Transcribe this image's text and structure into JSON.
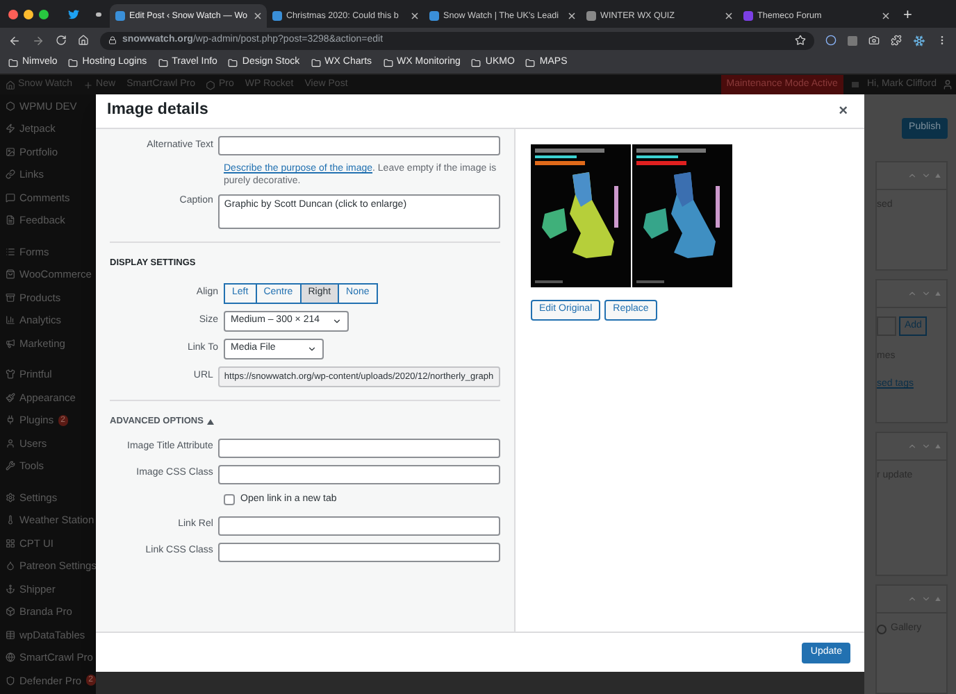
{
  "browser": {
    "tabs": [
      {
        "title": "Edit Post ‹ Snow Watch — Wo",
        "selected": true
      },
      {
        "title": "Christmas 2020: Could this b",
        "selected": false
      },
      {
        "title": "Snow Watch | The UK's Leadi",
        "selected": false
      },
      {
        "title": "WINTER WX QUIZ",
        "selected": false
      },
      {
        "title": "Themeco Forum",
        "selected": false
      }
    ],
    "new_tab": "+",
    "address": "**snowwatch.org**/wp-admin/post.php?post=3298&action=edit",
    "bookmarks": [
      "Nimvelo",
      "Hosting Logins",
      "Travel Info",
      "Design Stock",
      "WX Charts",
      "WX Monitoring",
      "UKMO",
      "MAPS"
    ]
  },
  "admin_bar": {
    "items": [
      "Snow Watch",
      "New",
      "SmartCrawl Pro",
      "Pro",
      "WP Rocket",
      "View Post"
    ],
    "notice": "Maintenance Mode Active",
    "greeting": "Hi, Mark Clifford"
  },
  "sidebar": {
    "groups": [
      [
        {
          "label": "WPMU DEV"
        },
        {
          "label": "Jetpack"
        },
        {
          "label": "Portfolio"
        },
        {
          "label": "Links"
        },
        {
          "label": "Comments"
        },
        {
          "label": "Feedback"
        }
      ],
      [
        {
          "label": "Forms"
        },
        {
          "label": "WooCommerce"
        },
        {
          "label": "Products"
        },
        {
          "label": "Analytics"
        },
        {
          "label": "Marketing"
        }
      ],
      [
        {
          "label": "Printful"
        },
        {
          "label": "Appearance"
        },
        {
          "label": "Plugins",
          "badge": "2"
        },
        {
          "label": "Users"
        },
        {
          "label": "Tools"
        }
      ],
      [
        {
          "label": "Settings"
        },
        {
          "label": "Weather Station"
        },
        {
          "label": "CPT UI"
        },
        {
          "label": "Patreon Settings"
        },
        {
          "label": "Shipper"
        },
        {
          "label": "Branda Pro"
        },
        {
          "label": "wpDataTables"
        },
        {
          "label": "SmartCrawl Pro"
        },
        {
          "label": "Defender Pro",
          "badge": "2"
        }
      ]
    ]
  },
  "dialog": {
    "title": "Image details",
    "close": "×",
    "alt_text": {
      "label": "Alternative Text",
      "help_link": "Describe the purpose of the image",
      "help": ". Leave empty if the image is purely decorative."
    },
    "caption": {
      "label": "Caption",
      "value": "Graphic by Scott Duncan (click to enlarge)"
    },
    "display_heading": "DISPLAY SETTINGS",
    "align": {
      "label": "Align",
      "options": [
        {
          "label": "Left",
          "selected": false
        },
        {
          "label": "Centre",
          "selected": false
        },
        {
          "label": "Right",
          "selected": true
        },
        {
          "label": "None",
          "selected": false
        }
      ]
    },
    "size": {
      "label": "Size",
      "value": "Medium – 300 × 214"
    },
    "link_to": {
      "label": "Link To",
      "value": "Media File"
    },
    "url": {
      "label": "URL",
      "value": "https://snowwatch.org/wp-content/uploads/2020/12/northerly_graph"
    },
    "advanced": {
      "heading": "ADVANCED OPTIONS",
      "expanded": true
    },
    "advanced_fields": [
      {
        "kind": "input",
        "label": "Image Title Attribute"
      },
      {
        "kind": "input",
        "label": "Image CSS Class"
      },
      {
        "kind": "checkbox",
        "label": "Open link in a new tab",
        "checked": false
      },
      {
        "kind": "input",
        "label": "Link Rel"
      },
      {
        "kind": "input",
        "label": "Link CSS Class"
      }
    ],
    "image_buttons": [
      "Edit Original",
      "Replace"
    ],
    "update_button": "Update"
  },
  "background_panel": {
    "publish": "Publish",
    "panels": [
      [
        {
          "kind": "text",
          "text": "sed"
        }
      ],
      [
        {
          "kind": "add",
          "text": "Add"
        },
        {
          "kind": "text",
          "text": "mes"
        },
        {
          "kind": "link",
          "text": "sed tags"
        }
      ],
      [
        {
          "kind": "text",
          "text": "r update"
        }
      ],
      [
        {
          "kind": "radio",
          "text": "Gallery",
          "checked": false
        }
      ]
    ]
  }
}
